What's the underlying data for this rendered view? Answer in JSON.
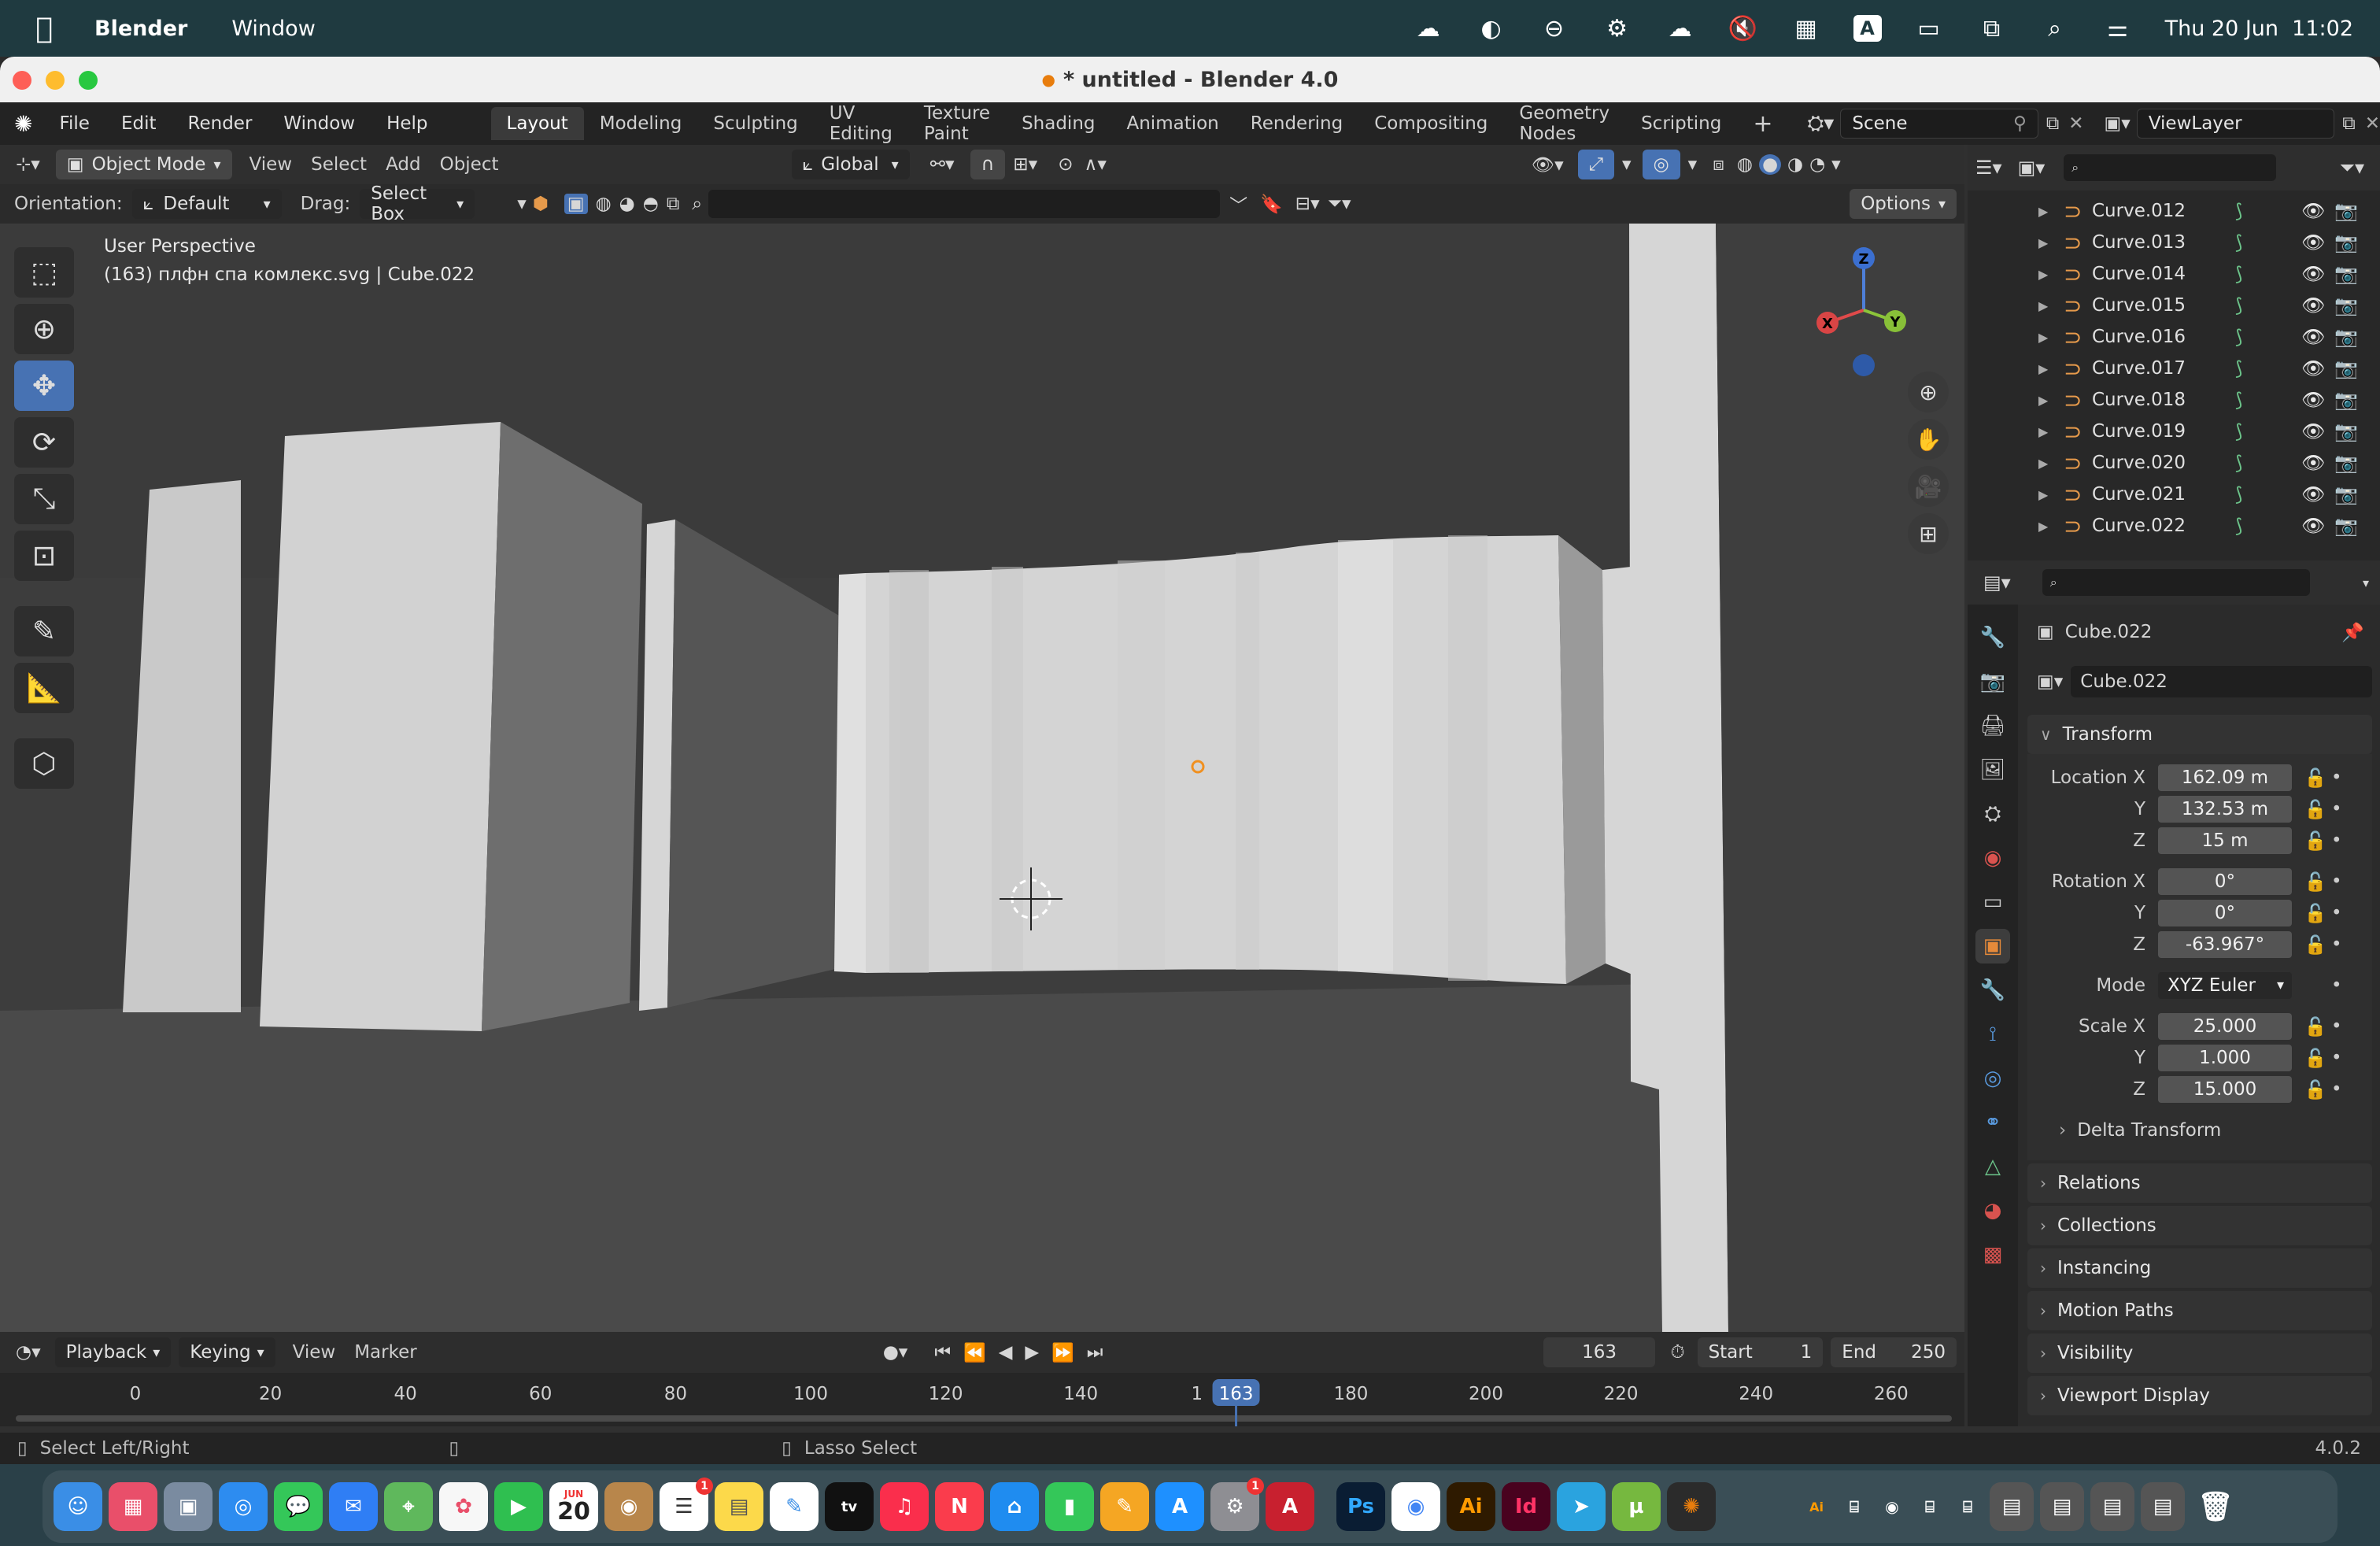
{
  "menubar": {
    "app_name": "Blender",
    "menu_window": "Window",
    "clock": "Thu 20 Jun  11:02",
    "input_source": "A"
  },
  "window": {
    "title": "* untitled - Blender 4.0"
  },
  "topbar": {
    "menus": [
      "File",
      "Edit",
      "Render",
      "Window",
      "Help"
    ],
    "workspaces": [
      "Layout",
      "Modeling",
      "Sculpting",
      "UV Editing",
      "Texture Paint",
      "Shading",
      "Animation",
      "Rendering",
      "Compositing",
      "Geometry Nodes",
      "Scripting"
    ],
    "active_workspace": "Layout",
    "add_workspace": "+",
    "scene": "Scene",
    "view_layer": "ViewLayer"
  },
  "viewport_header": {
    "mode": "Object Mode",
    "menus": [
      "View",
      "Select",
      "Add",
      "Object"
    ],
    "transform_orientation": "Global"
  },
  "tool_settings": {
    "orientation_label": "Orientation:",
    "orientation_value": "Default",
    "drag_label": "Drag:",
    "drag_value": "Select Box",
    "options_label": "Options"
  },
  "viewport": {
    "perspective": "User Perspective",
    "object_info": "(163) плфн спа комлекс.svg | Cube.022"
  },
  "gizmo": {
    "axis_x": "X",
    "axis_y": "Y",
    "axis_z": "Z"
  },
  "outliner": {
    "items": [
      {
        "name": "Curve.012"
      },
      {
        "name": "Curve.013"
      },
      {
        "name": "Curve.014"
      },
      {
        "name": "Curve.015"
      },
      {
        "name": "Curve.016"
      },
      {
        "name": "Curve.017"
      },
      {
        "name": "Curve.018"
      },
      {
        "name": "Curve.019"
      },
      {
        "name": "Curve.020"
      },
      {
        "name": "Curve.021"
      },
      {
        "name": "Curve.022"
      }
    ]
  },
  "properties": {
    "object_name": "Cube.022",
    "object_field": "Cube.022",
    "transform_label": "Transform",
    "location_label": "Location X",
    "location": {
      "x": "162.09 m",
      "y": "132.53 m",
      "z": "15 m"
    },
    "rotation_label": "Rotation X",
    "rotation": {
      "x": "0°",
      "y": "0°",
      "z": "-63.967°"
    },
    "mode_label": "Mode",
    "rotation_mode": "XYZ Euler",
    "scale_label": "Scale X",
    "scale": {
      "x": "25.000",
      "y": "1.000",
      "z": "15.000"
    },
    "axis_y": "Y",
    "axis_z": "Z",
    "delta_transform": "Delta Transform",
    "sections": [
      "Relations",
      "Collections",
      "Instancing",
      "Motion Paths",
      "Visibility",
      "Viewport Display"
    ]
  },
  "timeline": {
    "menus": [
      "Playback",
      "Keying",
      "View",
      "Marker"
    ],
    "current_frame": "163",
    "start_label": "Start",
    "start_value": "1",
    "end_label": "End",
    "end_value": "250",
    "ticks": [
      "0",
      "20",
      "40",
      "60",
      "80",
      "100",
      "120",
      "140",
      "180",
      "200",
      "220",
      "240",
      "260"
    ],
    "ticks_values": [
      0,
      20,
      40,
      60,
      80,
      100,
      120,
      140,
      180,
      200,
      220,
      240,
      260
    ],
    "partial_tick": "1",
    "playhead_value": 163
  },
  "status_bar": {
    "left_hint": "Select Left/Right",
    "middle_hint": "Lasso Select",
    "version": "4.0.2"
  },
  "dock": {
    "calendar_month": "JUN",
    "calendar_day": "20",
    "badge_reminders": "1",
    "badge_settings": "1"
  },
  "colors": {
    "accent": "#4772b3",
    "menubar": "#1f3a40",
    "object_orange": "#e69a4b"
  }
}
